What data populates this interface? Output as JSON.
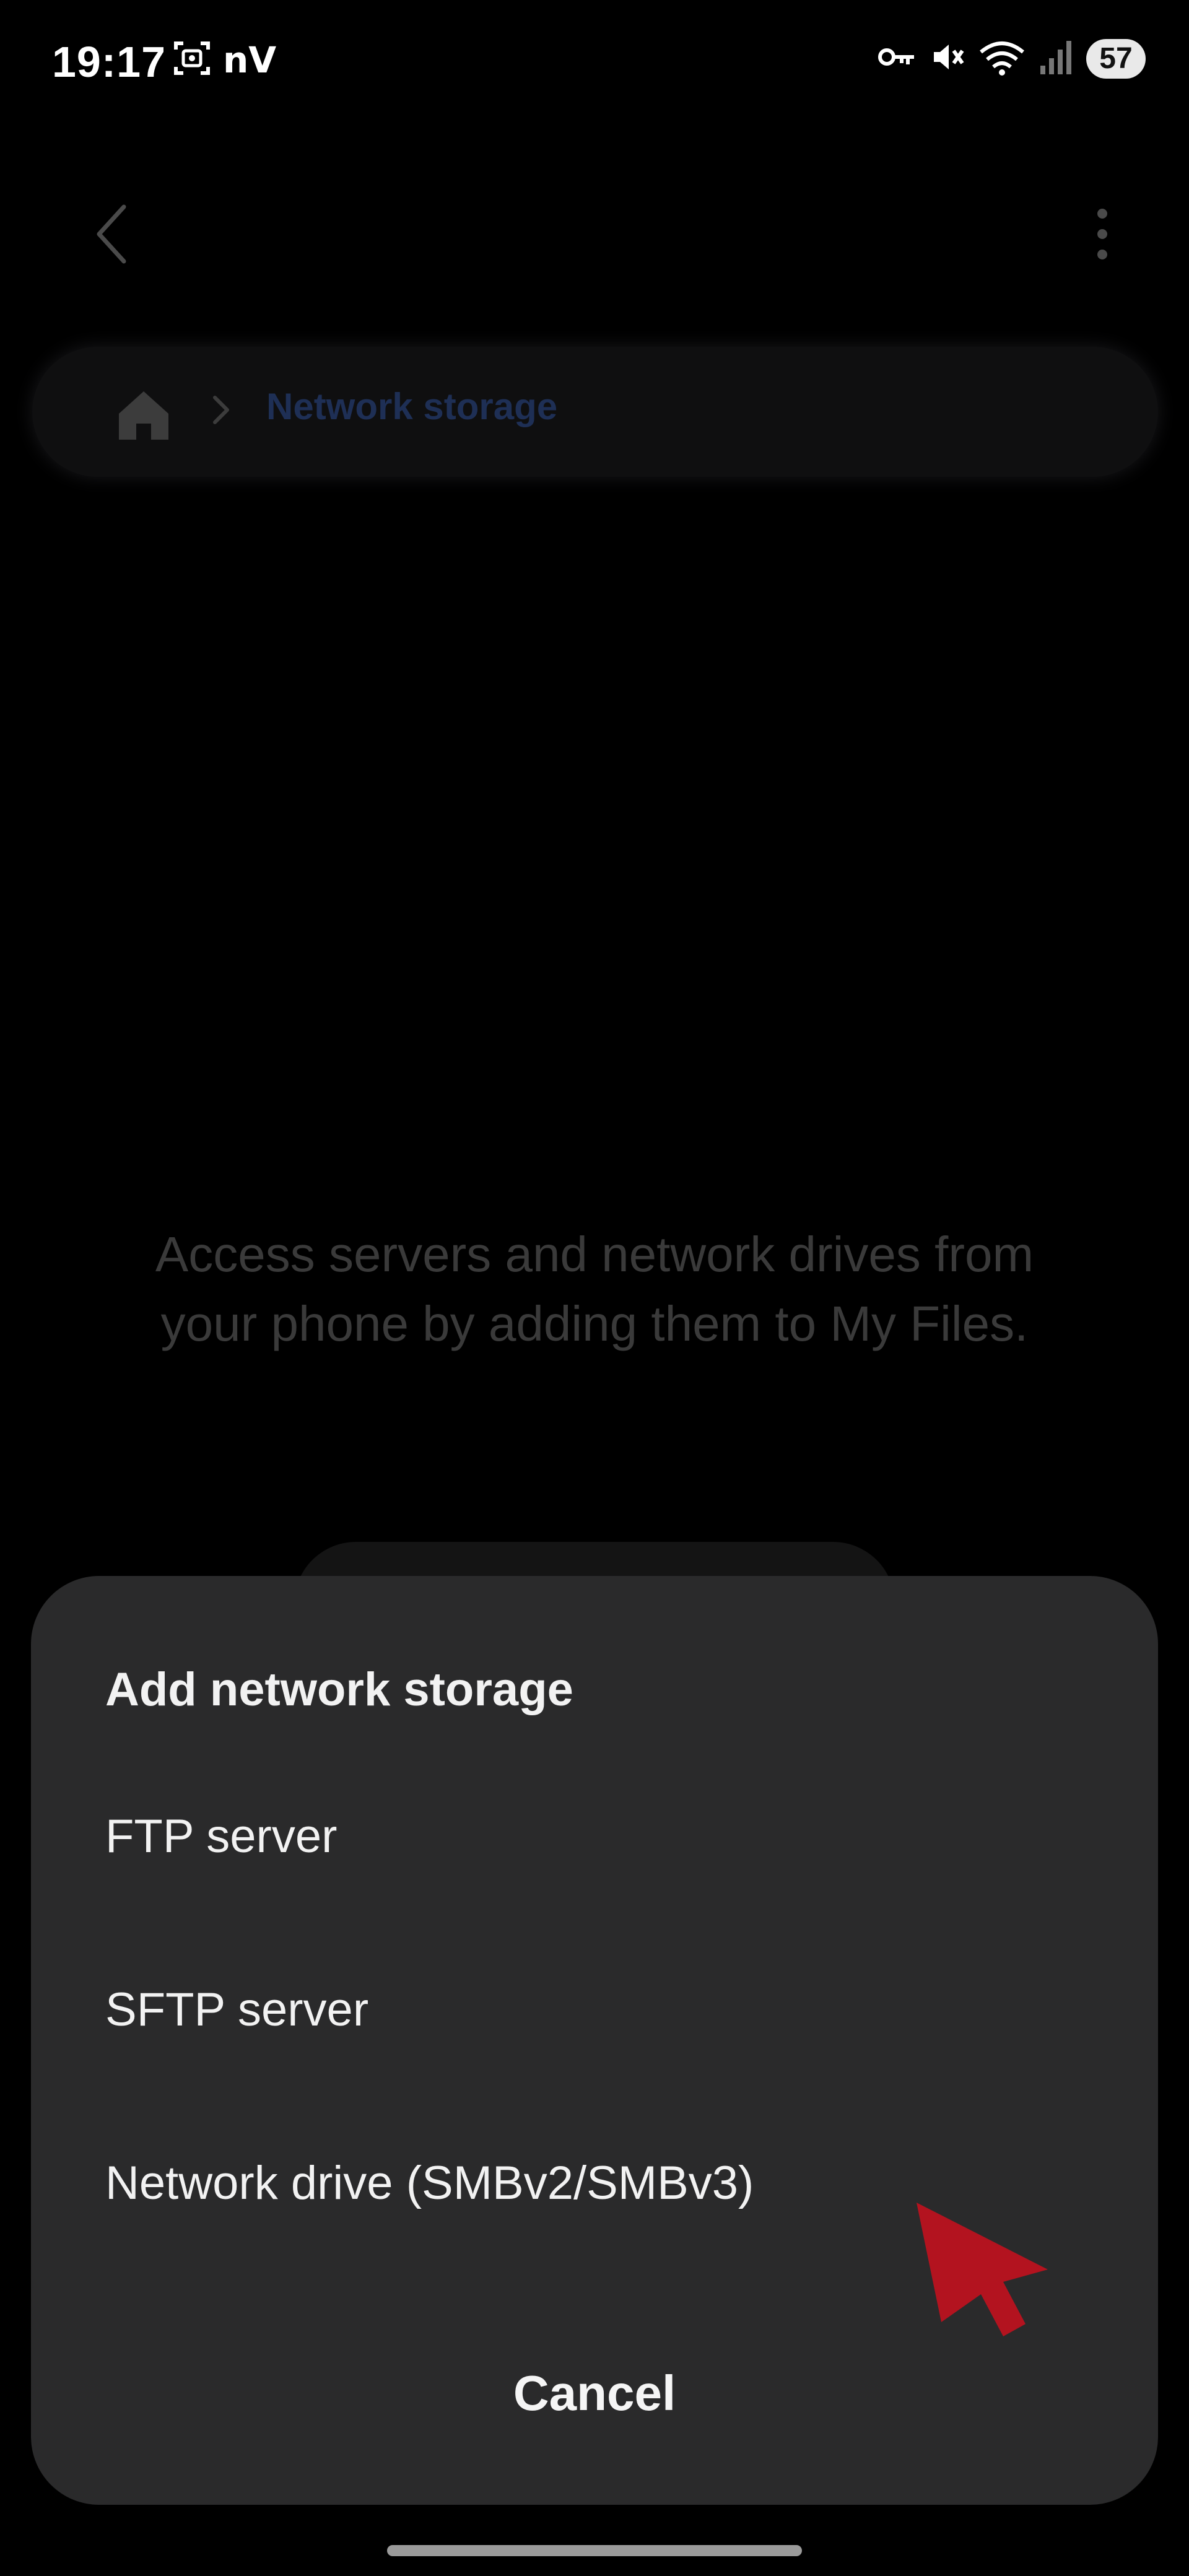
{
  "status_bar": {
    "time": "19:17",
    "carrier_text": "nV",
    "battery_level": "57",
    "icons": [
      "screen-record-icon",
      "vpn-key-icon",
      "mute-vibrate-icon",
      "wifi-icon",
      "signal-icon",
      "battery-icon"
    ]
  },
  "app_bar": {
    "back_icon": "chevron-left-icon",
    "more_icon": "more-vertical-icon"
  },
  "breadcrumb": {
    "home_icon": "home-icon",
    "separator_icon": "chevron-right-icon",
    "label": "Network storage"
  },
  "empty_state": {
    "message": "Access servers and network drives from your phone by adding them to My Files."
  },
  "sheet": {
    "title": "Add network storage",
    "options": [
      {
        "label": "FTP server"
      },
      {
        "label": "SFTP server"
      },
      {
        "label": "Network drive (SMBv2/SMBv3)"
      }
    ],
    "cancel_label": "Cancel"
  },
  "pointer": {
    "icon": "cursor-arrow-icon",
    "color": "#b3131f"
  },
  "colors": {
    "background": "#000000",
    "sheet": "#2a2a2b",
    "breadcrumb_text": "#1e2f55",
    "pointer": "#b3131f"
  }
}
